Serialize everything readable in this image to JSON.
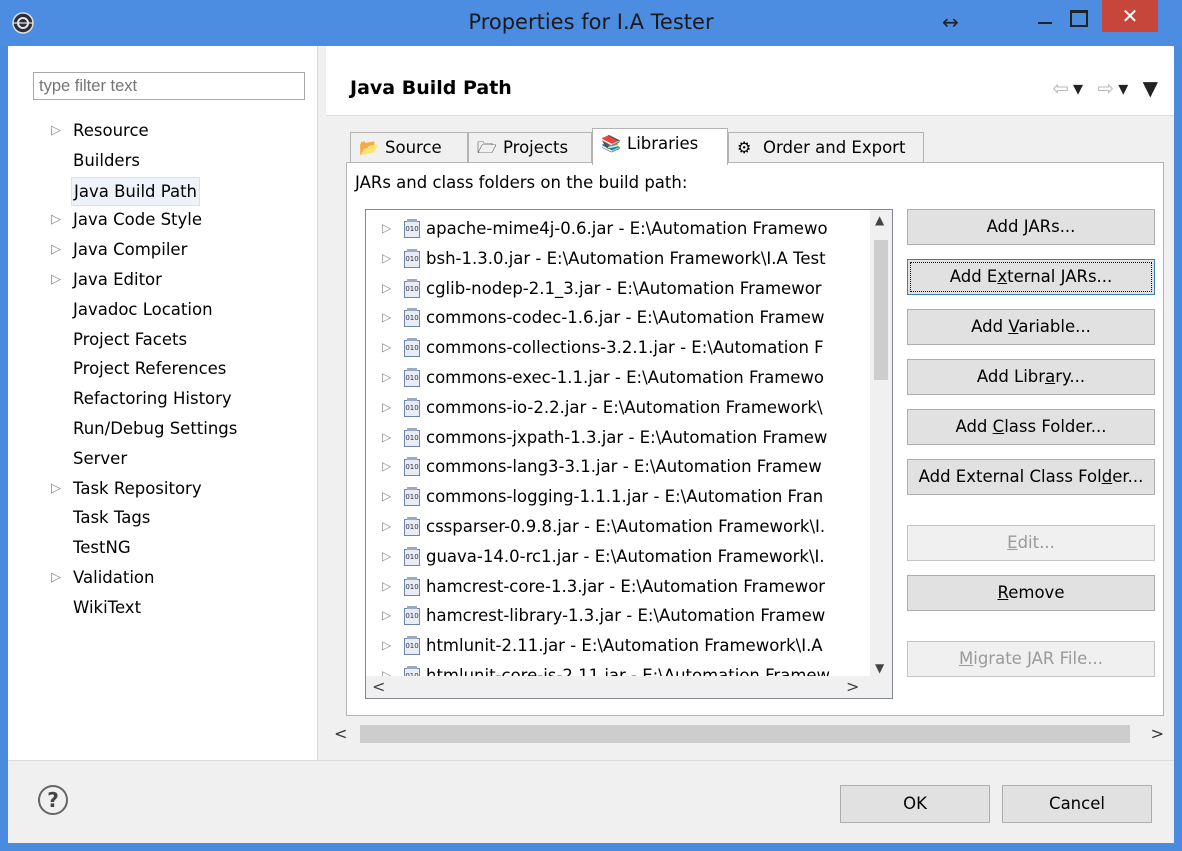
{
  "window": {
    "title": "Properties for I.A Tester",
    "resize_icon": "↔",
    "close_glyph": "✕",
    "accent_color": "#4c8ce1",
    "close_color": "#c7453b"
  },
  "filter": {
    "placeholder": "type filter text"
  },
  "sidebar": {
    "items": [
      {
        "label": "Resource",
        "expandable": true
      },
      {
        "label": "Builders",
        "expandable": false
      },
      {
        "label": "Java Build Path",
        "expandable": false,
        "selected": true
      },
      {
        "label": "Java Code Style",
        "expandable": true
      },
      {
        "label": "Java Compiler",
        "expandable": true
      },
      {
        "label": "Java Editor",
        "expandable": true
      },
      {
        "label": "Javadoc Location",
        "expandable": false
      },
      {
        "label": "Project Facets",
        "expandable": false
      },
      {
        "label": "Project References",
        "expandable": false
      },
      {
        "label": "Refactoring History",
        "expandable": false
      },
      {
        "label": "Run/Debug Settings",
        "expandable": false
      },
      {
        "label": "Server",
        "expandable": false
      },
      {
        "label": "Task Repository",
        "expandable": true
      },
      {
        "label": "Task Tags",
        "expandable": false
      },
      {
        "label": "TestNG",
        "expandable": false
      },
      {
        "label": "Validation",
        "expandable": true
      },
      {
        "label": "WikiText",
        "expandable": false
      }
    ]
  },
  "page": {
    "title": "Java Build Path",
    "tabs": [
      {
        "label": "Source",
        "icon": "source-folder-icon"
      },
      {
        "label": "Projects",
        "icon": "projects-folder-icon"
      },
      {
        "label": "Libraries",
        "icon": "libraries-icon",
        "active": true
      },
      {
        "label": "Order and Export",
        "icon": "order-export-icon"
      }
    ],
    "panel_label": "JARs and class folders on the build path:",
    "libraries": [
      "apache-mime4j-0.6.jar - E:\\Automation Framewo",
      "bsh-1.3.0.jar - E:\\Automation Framework\\I.A Test",
      "cglib-nodep-2.1_3.jar - E:\\Automation Framewor",
      "commons-codec-1.6.jar - E:\\Automation Framew",
      "commons-collections-3.2.1.jar - E:\\Automation F",
      "commons-exec-1.1.jar - E:\\Automation Framewo",
      "commons-io-2.2.jar - E:\\Automation Framework\\",
      "commons-jxpath-1.3.jar - E:\\Automation Framew",
      "commons-lang3-3.1.jar - E:\\Automation Framew",
      "commons-logging-1.1.1.jar - E:\\Automation Fran",
      "cssparser-0.9.8.jar - E:\\Automation Framework\\I.",
      "guava-14.0-rc1.jar - E:\\Automation Framework\\I.",
      "hamcrest-core-1.3.jar - E:\\Automation Framewor",
      "hamcrest-library-1.3.jar - E:\\Automation Framew",
      "htmlunit-2.11.jar - E:\\Automation Framework\\I.A",
      "htmlunit-core-js-2.11.jar - E:\\Automation Framew"
    ],
    "jar_badge": "010",
    "buttons": {
      "add_jars": {
        "pre": "Add ",
        "ul": "J",
        "post": "ARs..."
      },
      "add_external_jars": {
        "pre": "Add E",
        "ul": "x",
        "post": "ternal JARs..."
      },
      "add_variable": {
        "pre": "Add ",
        "ul": "V",
        "post": "ariable..."
      },
      "add_library": {
        "pre": "Add Libr",
        "ul": "a",
        "post": "ry..."
      },
      "add_class_folder": {
        "pre": "Add ",
        "ul": "C",
        "post": "lass Folder..."
      },
      "add_external_class_folder": {
        "pre": "Add External Class Fol",
        "ul": "d",
        "post": "er..."
      },
      "edit": {
        "pre": "",
        "ul": "E",
        "post": "dit..."
      },
      "remove": {
        "pre": "",
        "ul": "R",
        "post": "emove"
      },
      "migrate_jar": {
        "pre": "",
        "ul": "M",
        "post": "igrate JAR File..."
      }
    }
  },
  "footer": {
    "help": "?",
    "ok": "OK",
    "cancel": "Cancel"
  }
}
